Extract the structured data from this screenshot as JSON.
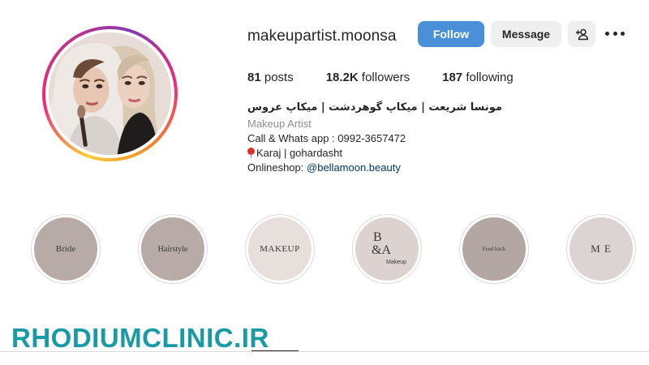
{
  "profile": {
    "username": "makeupartist.moonsa",
    "follow_label": "Follow",
    "message_label": "Message"
  },
  "stats": {
    "posts_count": "81",
    "posts_label": "posts",
    "followers_count": "18.2K",
    "followers_label": "followers",
    "following_count": "187",
    "following_label": "following"
  },
  "bio": {
    "full_name": "مونسا شریعت | میکاپ گوهردشت | میکاپ عروس",
    "category": "Makeup Artist",
    "contact": "Call & Whats app : 0992-3657472",
    "location": "Karaj | gohardasht",
    "shop_label": "Onlineshop:",
    "shop_handle": "@bellamoon.beauty"
  },
  "highlights": [
    {
      "label": "Bride",
      "color": "#b8aba7"
    },
    {
      "label": "Hairstyle",
      "color": "#b8aba7"
    },
    {
      "label": "MAKEUP",
      "color": "#e7dfdb"
    },
    {
      "label_line1": "B",
      "label_line2": "&A",
      "label_line3": "Makeup",
      "color": "#dcd3d1"
    },
    {
      "label": "Feed back",
      "color": "#b4a6a3"
    },
    {
      "label": "M E",
      "color": "#dcd4d2"
    }
  ],
  "watermark": "RHODIUMCLINIC.IR",
  "icons": {
    "add_user": "add-user-icon",
    "more": "more-options-icon"
  },
  "colors": {
    "follow_button": "#4a90d9",
    "link": "#00376b",
    "watermark": "#1a9aa5"
  }
}
